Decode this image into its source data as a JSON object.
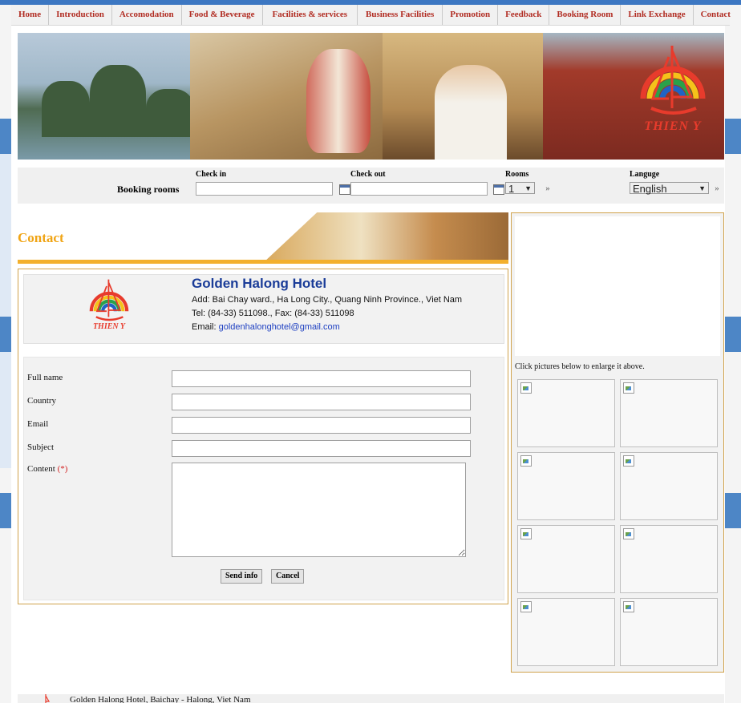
{
  "nav": {
    "items": [
      {
        "label": "Home"
      },
      {
        "label": "Introduction"
      },
      {
        "label": "Accomodation"
      },
      {
        "label": "Food & Beverage"
      },
      {
        "label": "Facilities & services"
      },
      {
        "label": "Business Facilities"
      },
      {
        "label": "Promotion"
      },
      {
        "label": "Feedback"
      },
      {
        "label": "Booking Room"
      },
      {
        "label": "Link Exchange"
      },
      {
        "label": "Contact"
      }
    ]
  },
  "banner": {
    "logo_text": "THIEN Y",
    "icon": "sailboat-logo"
  },
  "booking": {
    "title": "Booking rooms",
    "checkin_label": "Check in",
    "checkin_value": "",
    "checkout_label": "Check out",
    "checkout_value": "",
    "rooms_label": "Rooms",
    "rooms_value": "1",
    "language_label": "Languge",
    "language_value": "English"
  },
  "contact": {
    "heading": "Contact",
    "hotel_name": "Golden Halong Hotel",
    "logo_text": "THIEN Y",
    "address": "Add: Bai Chay ward., Ha Long City., Quang Ninh Province., Viet Nam",
    "phone": "Tel: (84-33) 511098., Fax: (84-33) 511098",
    "email_label": "Email: ",
    "email": "goldenhalonghotel@gmail.com"
  },
  "form": {
    "full_name_label": "Full name",
    "country_label": "Country",
    "email_label": "Email",
    "subject_label": "Subject",
    "content_label": "Content",
    "required_mark": "(*)",
    "send_label": "Send info",
    "cancel_label": "Cancel"
  },
  "gallery": {
    "hint": "Click pictures below to enlarge it above.",
    "thumb_count": 8
  },
  "footer": {
    "text": "Golden Halong Hotel, Baichay - Halong, Viet Nam"
  },
  "colors": {
    "nav_text": "#b12c22",
    "accent_orange": "#f0a414",
    "hotel_name": "#1a3c98",
    "link": "#1d3fc1",
    "required": "#d21e1e",
    "top_strip": "#3c77c2"
  }
}
